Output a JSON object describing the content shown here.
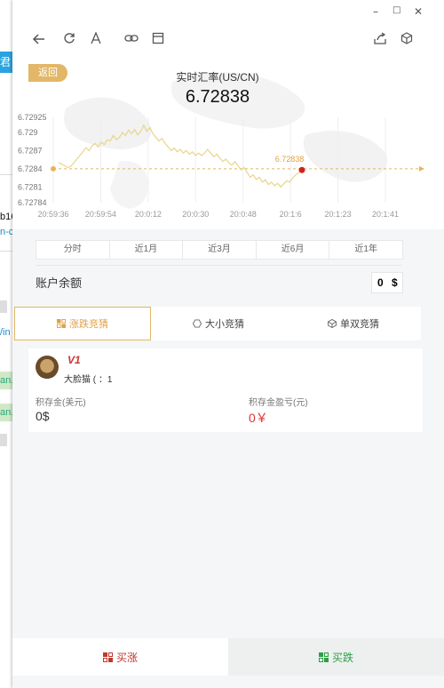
{
  "background_window": {
    "items": [
      {
        "text": "君",
        "kind": "blue"
      },
      {
        "text": "b16",
        "kind": "text"
      },
      {
        "text": "n-co",
        "kind": "link"
      },
      {
        "text": "/in",
        "kind": "link"
      },
      {
        "text": "an.",
        "kind": "green"
      },
      {
        "text": "an.",
        "kind": "green"
      }
    ]
  },
  "window_controls": {
    "minimize": "–",
    "maximize": "□",
    "close": "✕"
  },
  "toolbar": {
    "icons": [
      "back-icon",
      "refresh-icon",
      "font-icon",
      "link-icon",
      "window-icon",
      "share-icon",
      "cube-icon"
    ]
  },
  "header": {
    "back_label": "返回",
    "title": "实时汇率(US/CN)",
    "rate": "6.72838"
  },
  "chart_data": {
    "type": "line",
    "y_ticks": [
      "6.72925",
      "6.729",
      "6.7287",
      "6.7284",
      "6.7281",
      "6.72784"
    ],
    "x_ticks": [
      "20:59:36",
      "20:59:54",
      "20:0:12",
      "20:0:30",
      "20:0:48",
      "20:1:6",
      "20:1:23",
      "20:1:41"
    ],
    "ylim": [
      6.72784,
      6.72925
    ],
    "reference_value": 6.7284,
    "last_value_label": "6.72838",
    "line_color": "#e8d58a",
    "ref_color": "#e7b45a",
    "marker_color": "#d42020",
    "series": [
      {
        "values": [
          6.7285,
          6.72848,
          6.72845,
          6.72842,
          6.72844,
          6.7285,
          6.72856,
          6.72862,
          6.72868,
          6.72875,
          6.7287,
          6.72878,
          6.72882,
          6.72876,
          6.72884,
          6.7288,
          6.72888,
          6.72886,
          6.72895,
          6.72888,
          6.72892,
          6.729,
          6.72895,
          6.72904,
          6.72898,
          6.72905,
          6.72896,
          6.72902,
          6.72912,
          6.72902,
          6.72908,
          6.72898,
          6.72892,
          6.72886,
          6.7289,
          6.72882,
          6.72876,
          6.7287,
          6.72874,
          6.72868,
          6.72872,
          6.72866,
          6.7287,
          6.72864,
          6.72868,
          6.72862,
          6.72866,
          6.72862,
          6.72866,
          6.72872,
          6.72866,
          6.7286,
          6.72864,
          6.72858,
          6.72852,
          6.72856,
          6.7285,
          6.72846,
          6.72852,
          6.72845,
          6.72838,
          6.72842,
          6.72834,
          6.72826,
          6.7283,
          6.72822,
          6.72826,
          6.72818,
          6.72822,
          6.72814,
          6.72818,
          6.72812,
          6.72816,
          6.7281,
          6.72815,
          6.7282,
          6.72818,
          6.72825,
          6.7283,
          6.72834,
          6.72838
        ]
      }
    ]
  },
  "period_tabs": [
    {
      "label": "分时",
      "active": true
    },
    {
      "label": "近1月",
      "active": false
    },
    {
      "label": "近3月",
      "active": false
    },
    {
      "label": "近6月",
      "active": false
    },
    {
      "label": "近1年",
      "active": false
    }
  ],
  "balance": {
    "label": "账户余额",
    "amount": "0",
    "currency": "$"
  },
  "guess_tabs": [
    {
      "label": "涨跌竞猜",
      "icon": "updown-icon",
      "active": true
    },
    {
      "label": "大小竞猜",
      "icon": "size-icon",
      "active": false
    },
    {
      "label": "单双竞猜",
      "icon": "oddeven-icon",
      "active": false
    }
  ],
  "user": {
    "badge": "V1",
    "name": "大脸猫 ( ：1",
    "deposit_label": "积存金(美元)",
    "deposit_value": "0$",
    "profit_label": "积存金盈亏(元)",
    "profit_value": "0￥"
  },
  "actions": {
    "buy_up": "买涨",
    "buy_down": "买跌"
  }
}
